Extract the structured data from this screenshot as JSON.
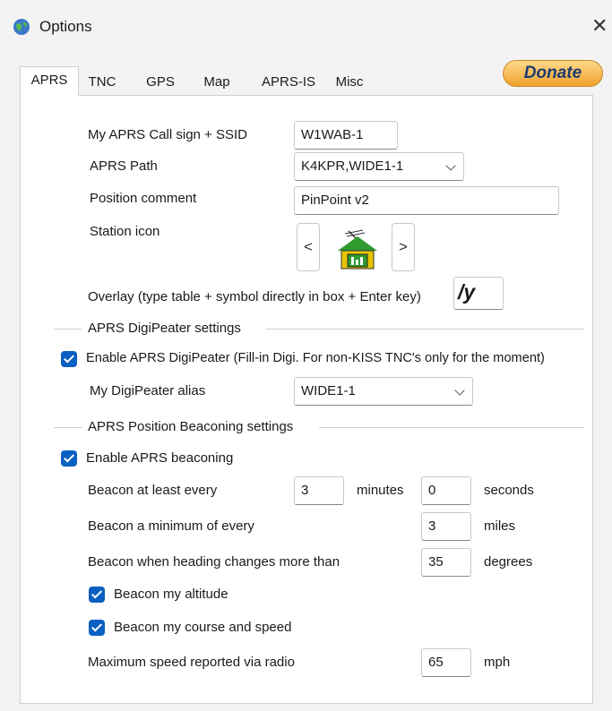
{
  "window": {
    "title": "Options",
    "close_glyph": "✕"
  },
  "tabs": [
    "APRS",
    "TNC",
    "GPS",
    "Map",
    "APRS-IS",
    "Misc"
  ],
  "donate_label": "Donate",
  "aprs": {
    "callsign_label": "My APRS Call sign + SSID",
    "callsign_value": "W1WAB-1",
    "path_label": "APRS Path",
    "path_value": "K4KPR,WIDE1-1",
    "comment_label": "Position comment",
    "comment_value": "PinPoint v2",
    "station_icon_label": "Station icon",
    "prev_glyph": "<",
    "next_glyph": ">",
    "overlay_label": "Overlay (type table + symbol directly in box + Enter key)",
    "overlay_value": "/y"
  },
  "digipeater": {
    "group_title": "APRS DigiPeater settings",
    "enable_label": "Enable APRS DigiPeater (Fill-in Digi. For non-KISS TNC's only for the moment)",
    "enable_checked": true,
    "alias_label": "My DigiPeater alias",
    "alias_value": "WIDE1-1"
  },
  "beaconing": {
    "group_title": "APRS Position Beaconing settings",
    "enable_label": "Enable APRS beaconing",
    "enable_checked": true,
    "every_label": "Beacon at least every",
    "every_minutes": "3",
    "minutes_unit": "minutes",
    "every_seconds": "0",
    "seconds_unit": "seconds",
    "min_every_label": "Beacon a minimum of every",
    "min_every_value": "3",
    "miles_unit": "miles",
    "heading_label": "Beacon when heading changes more than",
    "heading_value": "35",
    "degrees_unit": "degrees",
    "altitude_label": "Beacon my altitude",
    "altitude_checked": true,
    "course_label": "Beacon my course and speed",
    "course_checked": true,
    "max_speed_label": "Maximum speed reported via radio",
    "max_speed_value": "65",
    "mph_unit": "mph"
  },
  "colors": {
    "accent": "#0a5fc2",
    "donate_bg": "#f5b44a",
    "icon_green": "#2e9a2e"
  }
}
